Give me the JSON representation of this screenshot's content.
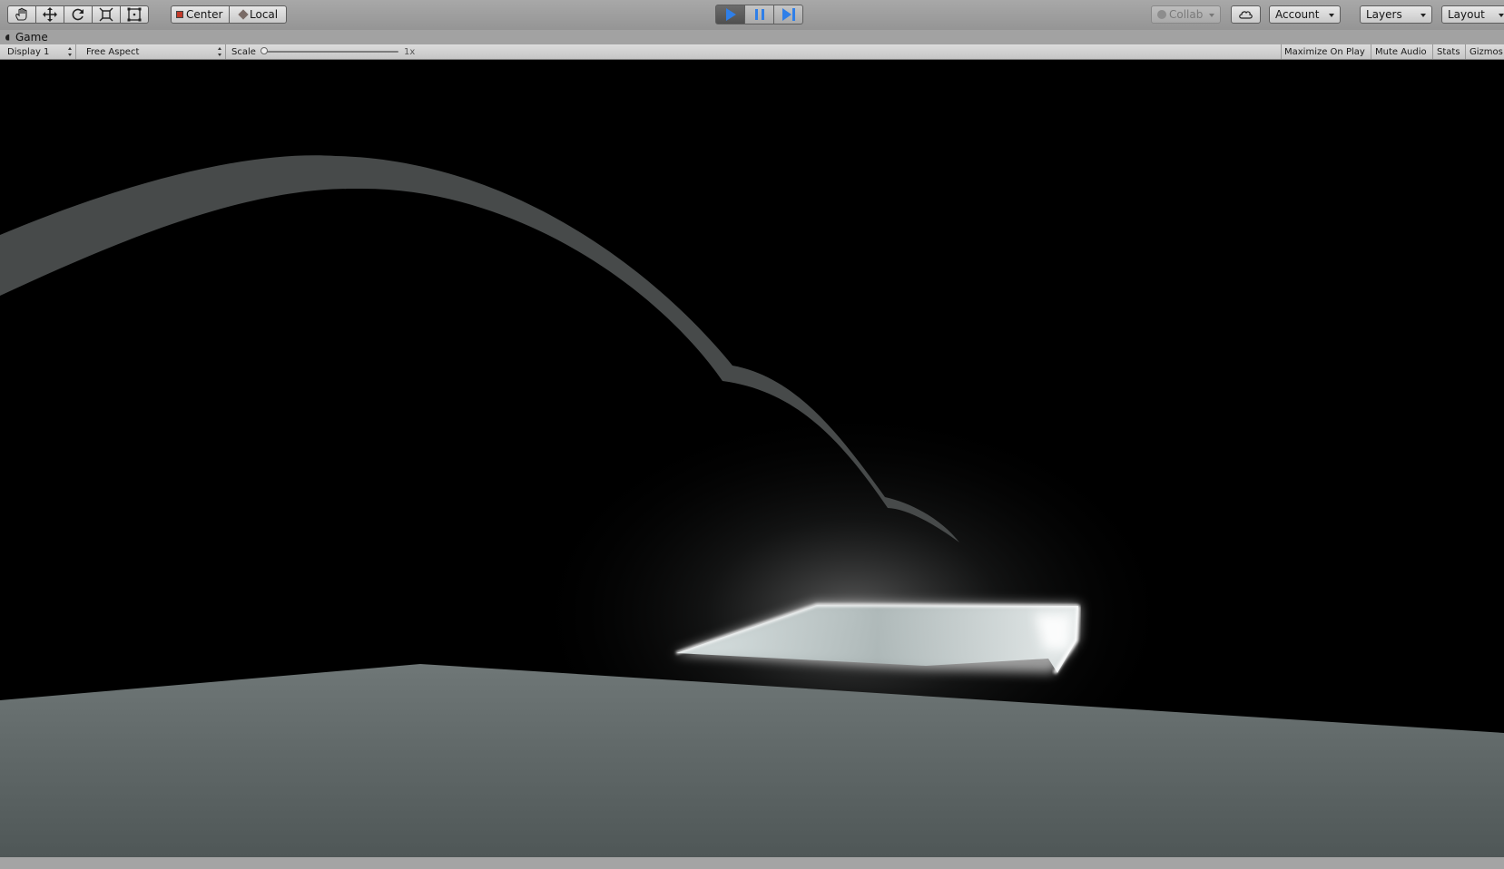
{
  "toolbar": {
    "tools": [
      {
        "name": "hand-tool-button",
        "icon": "hand-icon"
      },
      {
        "name": "move-tool-button",
        "icon": "move-arrows-icon"
      },
      {
        "name": "rotate-tool-button",
        "icon": "rotate-icon"
      },
      {
        "name": "scale-tool-button",
        "icon": "scale-icon"
      },
      {
        "name": "rect-tool-button",
        "icon": "rect-transform-icon"
      }
    ],
    "pivot_label": "Center",
    "space_label": "Local",
    "play": {
      "playing": true,
      "paused": false,
      "accent": "#2f7fe8"
    },
    "collab_label": "Collab",
    "account_label": "Account",
    "layers_label": "Layers",
    "layout_label": "Layout"
  },
  "tab": {
    "label": "Game"
  },
  "gamebar": {
    "display_label": "Display 1",
    "aspect_label": "Free Aspect",
    "scale_label": "Scale",
    "scale_value": "1x",
    "scale_slider_value": 0,
    "maximize_label": "Maximize On Play",
    "mute_label": "Mute Audio",
    "stats_label": "Stats",
    "gizmos_label": "Gizmos"
  },
  "scene": {
    "background": "#000000",
    "arc_color": "#474a4a",
    "ground_color": "#5d6565",
    "glow_color": "#ffffff",
    "platform_color": "#b9c4c4"
  }
}
